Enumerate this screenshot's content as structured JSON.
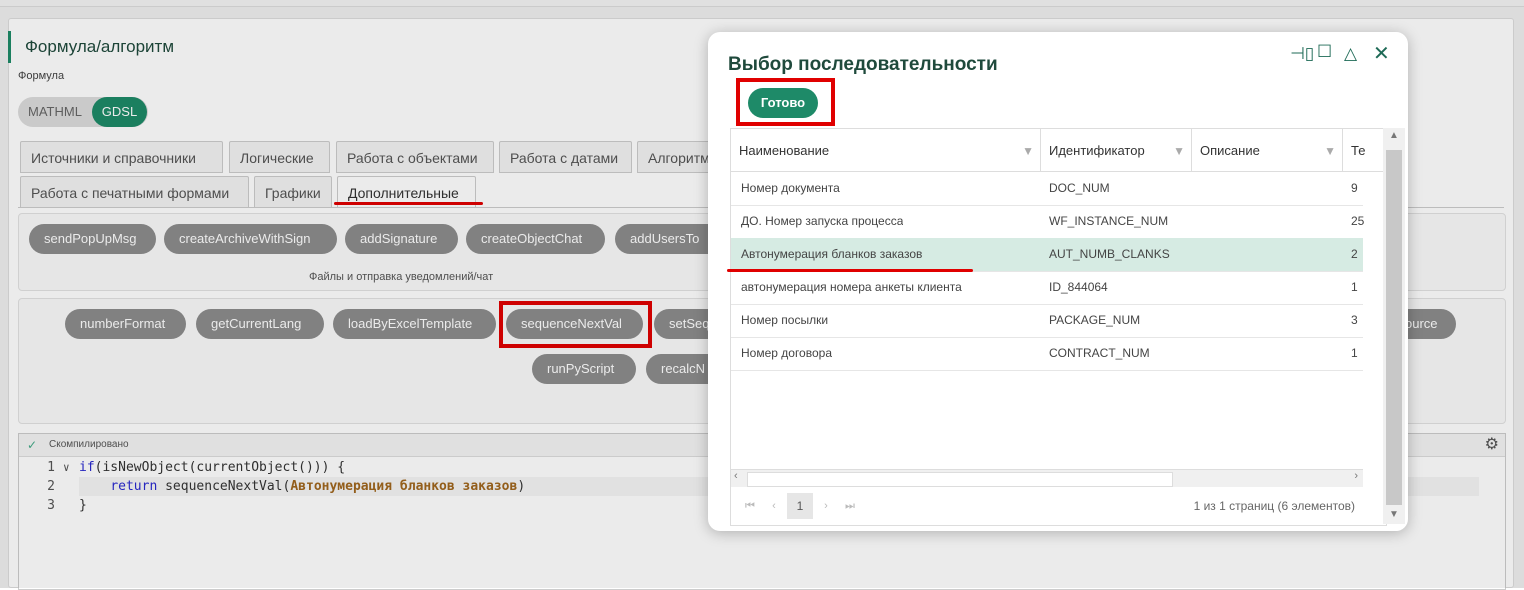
{
  "section": {
    "title": "Формула/алгоритм",
    "formula_label": "Формула"
  },
  "toggle": {
    "options": [
      "MATHML",
      "GDSL"
    ],
    "selected": "GDSL"
  },
  "tabs": {
    "row1": [
      "Источники и справочники",
      "Логические",
      "Работа с объектами",
      "Работа с датами",
      "Алгоритм"
    ],
    "row2": [
      "Работа с печатными формами",
      "Графики",
      "Дополнительные"
    ],
    "active": "Дополнительные"
  },
  "group1": {
    "functions": [
      "sendPopUpMsg",
      "createArchiveWithSign",
      "addSignature",
      "createObjectChat",
      "addUsersTo"
    ],
    "caption": "Файлы и отправка уведомлений/чат"
  },
  "group2": {
    "functions_row1": [
      "numberFormat",
      "getCurrentLang",
      "loadByExcelTemplate",
      "sequenceNextVal",
      "setSeq",
      "ource"
    ],
    "functions_row2": [
      "runPyScript",
      "recalcN"
    ]
  },
  "editor": {
    "status": "Скомпилировано",
    "lines": [
      {
        "n": "1",
        "pre": "if(isNewObject(currentObject())) {"
      },
      {
        "n": "2",
        "kw": "return",
        "fn": " sequenceNextVal(",
        "arg": "Автонумерация бланков заказов",
        "post": ")"
      },
      {
        "n": "3",
        "pre": "}"
      }
    ]
  },
  "modal": {
    "title": "Выбор последовательности",
    "ready_label": "Готово",
    "controls": [
      "pin-icon",
      "maximize-icon",
      "collapse-icon",
      "close-icon"
    ],
    "columns": [
      "Наименование",
      "Идентификатор",
      "Описание",
      "Те"
    ],
    "rows": [
      {
        "name": "Номер документа",
        "id": "DOC_NUM",
        "desc": "",
        "t": "9"
      },
      {
        "name": "ДО. Номер запуска процесса",
        "id": "WF_INSTANCE_NUM",
        "desc": "",
        "t": "25"
      },
      {
        "name": "Автонумерация бланков заказов",
        "id": "AUT_NUMB_CLANKS",
        "desc": "",
        "t": "2"
      },
      {
        "name": "автонумерация номера анкеты клиента",
        "id": "ID_844064",
        "desc": "",
        "t": "1"
      },
      {
        "name": "Номер посылки",
        "id": "PACKAGE_NUM",
        "desc": "",
        "t": "3"
      },
      {
        "name": "Номер договора",
        "id": "CONTRACT_NUM",
        "desc": "",
        "t": "1"
      }
    ],
    "selected_row": 2,
    "pager": {
      "page": "1",
      "info": "1 из 1 страниц (6 элементов)"
    }
  },
  "colors": {
    "accent": "#1e8a68",
    "highlight": "#e00000",
    "selected_row": "#d6ebe3"
  }
}
